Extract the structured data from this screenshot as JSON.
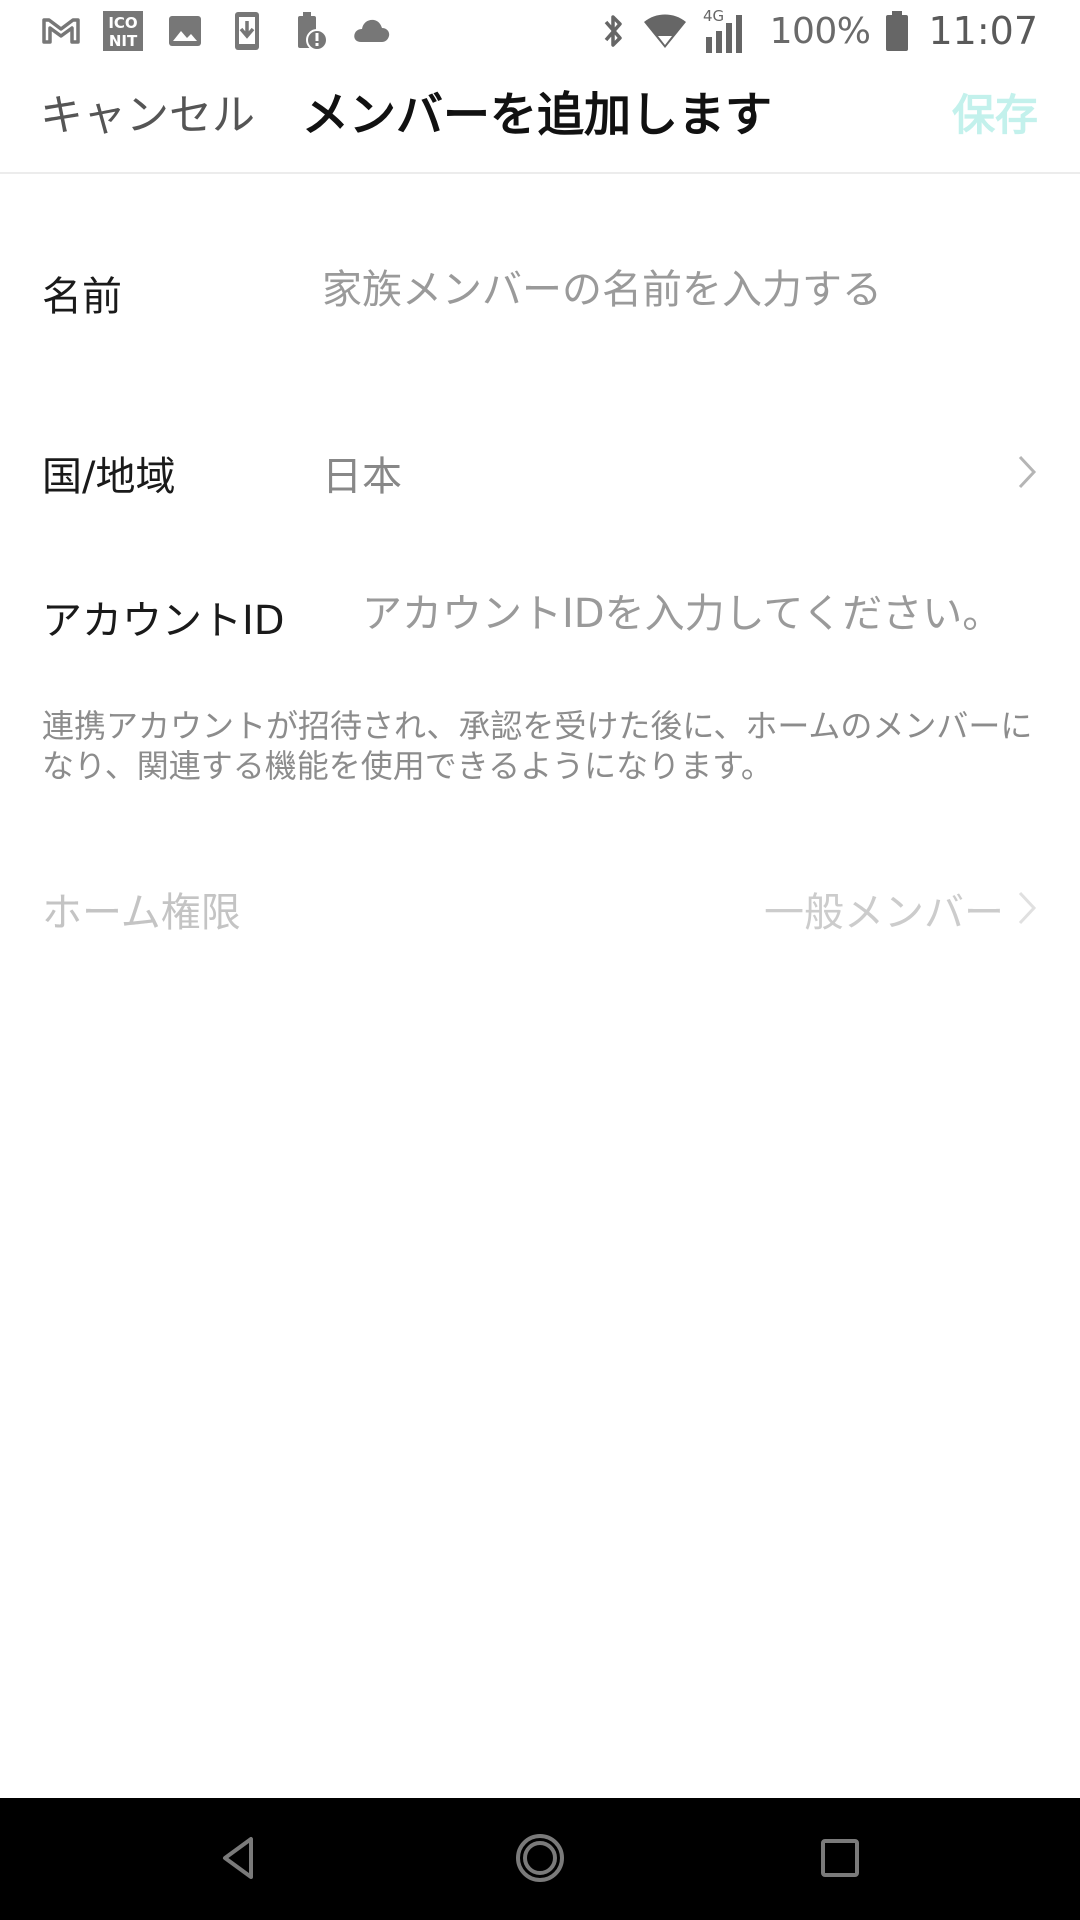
{
  "status_bar": {
    "notification_icons": [
      "gmail-icon",
      "iconit-app-icon",
      "image-icon",
      "download-icon",
      "battery-alert-icon",
      "cloud-icon"
    ],
    "system_icons": [
      "bluetooth-icon",
      "wifi-icon",
      "signal-4g-icon",
      "battery-icon"
    ],
    "network_label": "4G",
    "battery_percent": "100%",
    "time": "11:07"
  },
  "header": {
    "cancel_label": "キャンセル",
    "title": "メンバーを追加します",
    "save_label": "保存"
  },
  "form": {
    "name": {
      "label": "名前",
      "placeholder": "家族メンバーの名前を入力する",
      "value": ""
    },
    "region": {
      "label": "国/地域",
      "value": "日本"
    },
    "account": {
      "label": "アカウントID",
      "placeholder": "アカウントIDを入力してください。",
      "value": ""
    },
    "note": "連携アカウントが招待され、承認を受けた後に、ホームのメンバーになり、関連する機能を使用できるようになります。",
    "permission": {
      "label": "ホーム権限",
      "value": "一般メンバー"
    }
  },
  "colors": {
    "save_disabled": "#c3f1ec",
    "disabled_text": "#c4c4c4",
    "nav_bar": "#000000"
  },
  "nav_bar": {
    "icons": [
      "back-icon",
      "home-icon",
      "recents-icon"
    ]
  }
}
